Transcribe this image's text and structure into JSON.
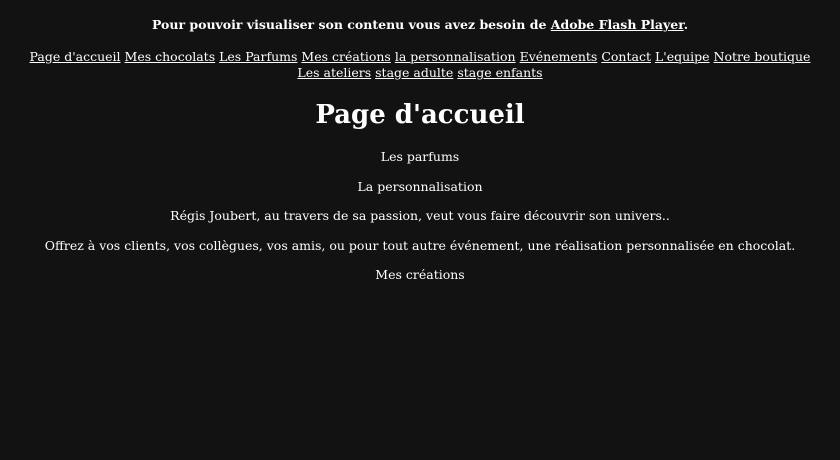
{
  "flash_notice": {
    "text": "Pour pouvoir visualiser son contenu vous avez besoin de ",
    "link": "Adobe Flash Player",
    "suffix": "."
  },
  "nav": {
    "items": [
      {
        "label": "Page d'accueil"
      },
      {
        "label": "Mes chocolats"
      },
      {
        "label": "Les Parfums"
      },
      {
        "label": "Mes créations"
      },
      {
        "label": "la personnalisation"
      },
      {
        "label": "Evénements"
      },
      {
        "label": "Contact"
      },
      {
        "label": "L'equipe"
      },
      {
        "label": "Notre boutique"
      },
      {
        "label": "Les ateliers"
      },
      {
        "label": "stage adulte"
      },
      {
        "label": "stage enfants"
      }
    ]
  },
  "main": {
    "title": "Page d'accueil",
    "paragraphs": [
      "Les parfums",
      "La personnalisation",
      "Régis Joubert, au travers de sa passion, veut vous faire découvrir son univers..",
      "Offrez à vos clients, vos collègues, vos amis, ou pour tout autre événement, une réalisation personnalisée en chocolat.",
      "Mes créations"
    ]
  }
}
